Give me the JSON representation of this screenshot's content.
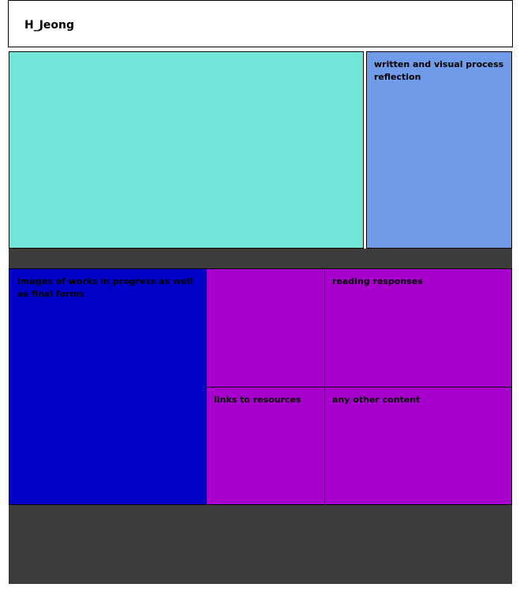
{
  "header": {
    "title": "H_Jeong"
  },
  "panels": {
    "reflection": "written and visual process reflection",
    "images": "images of works in progress as well as final forms",
    "reading": "reading responses",
    "links": "links to resources",
    "other": "any other content"
  },
  "colors": {
    "teal": "#74e6d9",
    "light_blue": "#6f9be8",
    "navy": "#0000c7",
    "purple": "#a800cc",
    "dark_gray": "#3c3c3c"
  }
}
